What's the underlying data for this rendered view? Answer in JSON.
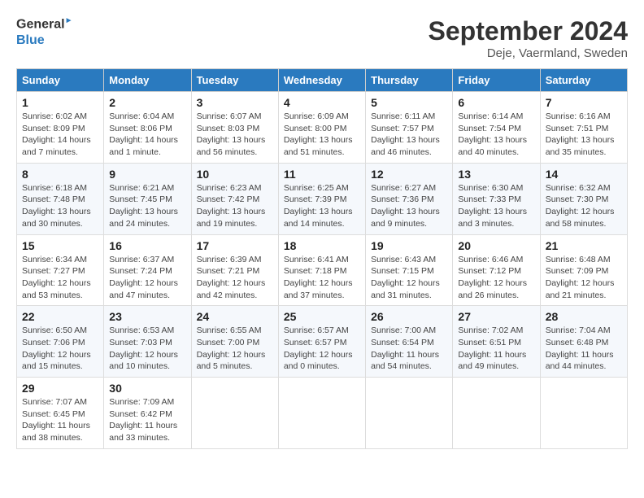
{
  "logo": {
    "line1": "General",
    "line2": "Blue"
  },
  "title": "September 2024",
  "subtitle": "Deje, Vaermland, Sweden",
  "weekdays": [
    "Sunday",
    "Monday",
    "Tuesday",
    "Wednesday",
    "Thursday",
    "Friday",
    "Saturday"
  ],
  "weeks": [
    [
      {
        "day": "1",
        "sunrise": "6:02 AM",
        "sunset": "8:09 PM",
        "daylight": "14 hours and 7 minutes."
      },
      {
        "day": "2",
        "sunrise": "6:04 AM",
        "sunset": "8:06 PM",
        "daylight": "14 hours and 1 minute."
      },
      {
        "day": "3",
        "sunrise": "6:07 AM",
        "sunset": "8:03 PM",
        "daylight": "13 hours and 56 minutes."
      },
      {
        "day": "4",
        "sunrise": "6:09 AM",
        "sunset": "8:00 PM",
        "daylight": "13 hours and 51 minutes."
      },
      {
        "day": "5",
        "sunrise": "6:11 AM",
        "sunset": "7:57 PM",
        "daylight": "13 hours and 46 minutes."
      },
      {
        "day": "6",
        "sunrise": "6:14 AM",
        "sunset": "7:54 PM",
        "daylight": "13 hours and 40 minutes."
      },
      {
        "day": "7",
        "sunrise": "6:16 AM",
        "sunset": "7:51 PM",
        "daylight": "13 hours and 35 minutes."
      }
    ],
    [
      {
        "day": "8",
        "sunrise": "6:18 AM",
        "sunset": "7:48 PM",
        "daylight": "13 hours and 30 minutes."
      },
      {
        "day": "9",
        "sunrise": "6:21 AM",
        "sunset": "7:45 PM",
        "daylight": "13 hours and 24 minutes."
      },
      {
        "day": "10",
        "sunrise": "6:23 AM",
        "sunset": "7:42 PM",
        "daylight": "13 hours and 19 minutes."
      },
      {
        "day": "11",
        "sunrise": "6:25 AM",
        "sunset": "7:39 PM",
        "daylight": "13 hours and 14 minutes."
      },
      {
        "day": "12",
        "sunrise": "6:27 AM",
        "sunset": "7:36 PM",
        "daylight": "13 hours and 9 minutes."
      },
      {
        "day": "13",
        "sunrise": "6:30 AM",
        "sunset": "7:33 PM",
        "daylight": "13 hours and 3 minutes."
      },
      {
        "day": "14",
        "sunrise": "6:32 AM",
        "sunset": "7:30 PM",
        "daylight": "12 hours and 58 minutes."
      }
    ],
    [
      {
        "day": "15",
        "sunrise": "6:34 AM",
        "sunset": "7:27 PM",
        "daylight": "12 hours and 53 minutes."
      },
      {
        "day": "16",
        "sunrise": "6:37 AM",
        "sunset": "7:24 PM",
        "daylight": "12 hours and 47 minutes."
      },
      {
        "day": "17",
        "sunrise": "6:39 AM",
        "sunset": "7:21 PM",
        "daylight": "12 hours and 42 minutes."
      },
      {
        "day": "18",
        "sunrise": "6:41 AM",
        "sunset": "7:18 PM",
        "daylight": "12 hours and 37 minutes."
      },
      {
        "day": "19",
        "sunrise": "6:43 AM",
        "sunset": "7:15 PM",
        "daylight": "12 hours and 31 minutes."
      },
      {
        "day": "20",
        "sunrise": "6:46 AM",
        "sunset": "7:12 PM",
        "daylight": "12 hours and 26 minutes."
      },
      {
        "day": "21",
        "sunrise": "6:48 AM",
        "sunset": "7:09 PM",
        "daylight": "12 hours and 21 minutes."
      }
    ],
    [
      {
        "day": "22",
        "sunrise": "6:50 AM",
        "sunset": "7:06 PM",
        "daylight": "12 hours and 15 minutes."
      },
      {
        "day": "23",
        "sunrise": "6:53 AM",
        "sunset": "7:03 PM",
        "daylight": "12 hours and 10 minutes."
      },
      {
        "day": "24",
        "sunrise": "6:55 AM",
        "sunset": "7:00 PM",
        "daylight": "12 hours and 5 minutes."
      },
      {
        "day": "25",
        "sunrise": "6:57 AM",
        "sunset": "6:57 PM",
        "daylight": "12 hours and 0 minutes."
      },
      {
        "day": "26",
        "sunrise": "7:00 AM",
        "sunset": "6:54 PM",
        "daylight": "11 hours and 54 minutes."
      },
      {
        "day": "27",
        "sunrise": "7:02 AM",
        "sunset": "6:51 PM",
        "daylight": "11 hours and 49 minutes."
      },
      {
        "day": "28",
        "sunrise": "7:04 AM",
        "sunset": "6:48 PM",
        "daylight": "11 hours and 44 minutes."
      }
    ],
    [
      {
        "day": "29",
        "sunrise": "7:07 AM",
        "sunset": "6:45 PM",
        "daylight": "11 hours and 38 minutes."
      },
      {
        "day": "30",
        "sunrise": "7:09 AM",
        "sunset": "6:42 PM",
        "daylight": "11 hours and 33 minutes."
      },
      null,
      null,
      null,
      null,
      null
    ]
  ]
}
